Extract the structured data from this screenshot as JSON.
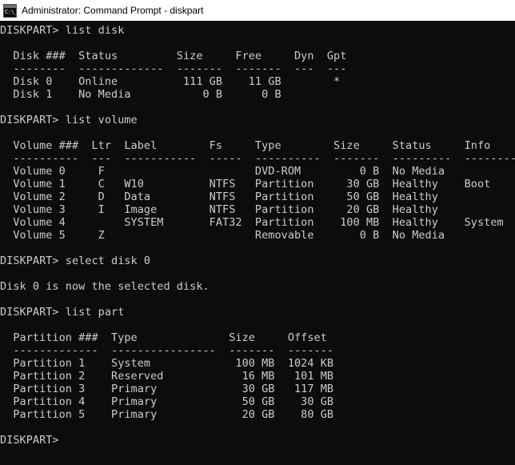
{
  "window": {
    "title": "Administrator: Command Prompt - diskpart",
    "icon": "command-prompt-icon",
    "icon_glyph": "C:\\_",
    "titlebar_bg": "#ffffff",
    "titlebar_fg": "#000000"
  },
  "console": {
    "background": "#0c0c0c",
    "foreground": "#cccccc",
    "prompt": "DISKPART>",
    "columns": 80,
    "font_size_px": 13.5,
    "line_height_px": 16,
    "screen_text": "DISKPART> list disk\n\n  Disk ###  Status         Size     Free     Dyn  Gpt\n  --------  -------------  -------  -------  ---  ---\n  Disk 0    Online          111 GB    11 GB        *\n  Disk 1    No Media           0 B      0 B\n\nDISKPART> list volume\n\n  Volume ###  Ltr  Label        Fs     Type        Size     Status     Info\n  ----------  ---  -----------  -----  ----------  -------  ---------  --------\n  Volume 0     F                       DVD-ROM         0 B  No Media\n  Volume 1     C   W10          NTFS   Partition     30 GB  Healthy    Boot\n  Volume 2     D   Data         NTFS   Partition     50 GB  Healthy\n  Volume 3     I   Image        NTFS   Partition     20 GB  Healthy\n  Volume 4         SYSTEM       FAT32  Partition    100 MB  Healthy    System\n  Volume 5     Z                       Removable       0 B  No Media\n\nDISKPART> select disk 0\n\nDisk 0 is now the selected disk.\n\nDISKPART> list part\n\n  Partition ###  Type              Size     Offset\n  -------------  ----------------  -------  -------\n  Partition 1    System             100 MB  1024 KB\n  Partition 2    Reserved            16 MB   101 MB\n  Partition 3    Primary             30 GB   117 MB\n  Partition 4    Primary             50 GB    30 GB\n  Partition 5    Primary             20 GB    80 GB\n\nDISKPART>"
  },
  "session": {
    "commands": [
      "list disk",
      "list volume",
      "select disk 0",
      "list part"
    ],
    "messages": [
      "Disk 0 is now the selected disk."
    ],
    "disk_table": {
      "headers": [
        "Disk ###",
        "Status",
        "Size",
        "Free",
        "Dyn",
        "Gpt"
      ],
      "rows": [
        [
          "Disk 0",
          "Online",
          "111 GB",
          "11 GB",
          "",
          "*"
        ],
        [
          "Disk 1",
          "No Media",
          "0 B",
          "0 B",
          "",
          ""
        ]
      ]
    },
    "volume_table": {
      "headers": [
        "Volume ###",
        "Ltr",
        "Label",
        "Fs",
        "Type",
        "Size",
        "Status",
        "Info"
      ],
      "rows": [
        [
          "Volume 0",
          "F",
          "",
          "",
          "DVD-ROM",
          "0 B",
          "No Media",
          ""
        ],
        [
          "Volume 1",
          "C",
          "W10",
          "NTFS",
          "Partition",
          "30 GB",
          "Healthy",
          "Boot"
        ],
        [
          "Volume 2",
          "D",
          "Data",
          "NTFS",
          "Partition",
          "50 GB",
          "Healthy",
          ""
        ],
        [
          "Volume 3",
          "I",
          "Image",
          "NTFS",
          "Partition",
          "20 GB",
          "Healthy",
          ""
        ],
        [
          "Volume 4",
          "",
          "SYSTEM",
          "FAT32",
          "Partition",
          "100 MB",
          "Healthy",
          "System"
        ],
        [
          "Volume 5",
          "Z",
          "",
          "",
          "Removable",
          "0 B",
          "No Media",
          ""
        ]
      ]
    },
    "partition_table": {
      "headers": [
        "Partition ###",
        "Type",
        "Size",
        "Offset"
      ],
      "rows": [
        [
          "Partition 1",
          "System",
          "100 MB",
          "1024 KB"
        ],
        [
          "Partition 2",
          "Reserved",
          "16 MB",
          "101 MB"
        ],
        [
          "Partition 3",
          "Primary",
          "30 GB",
          "117 MB"
        ],
        [
          "Partition 4",
          "Primary",
          "50 GB",
          "30 GB"
        ],
        [
          "Partition 5",
          "Primary",
          "20 GB",
          "80 GB"
        ]
      ]
    }
  }
}
